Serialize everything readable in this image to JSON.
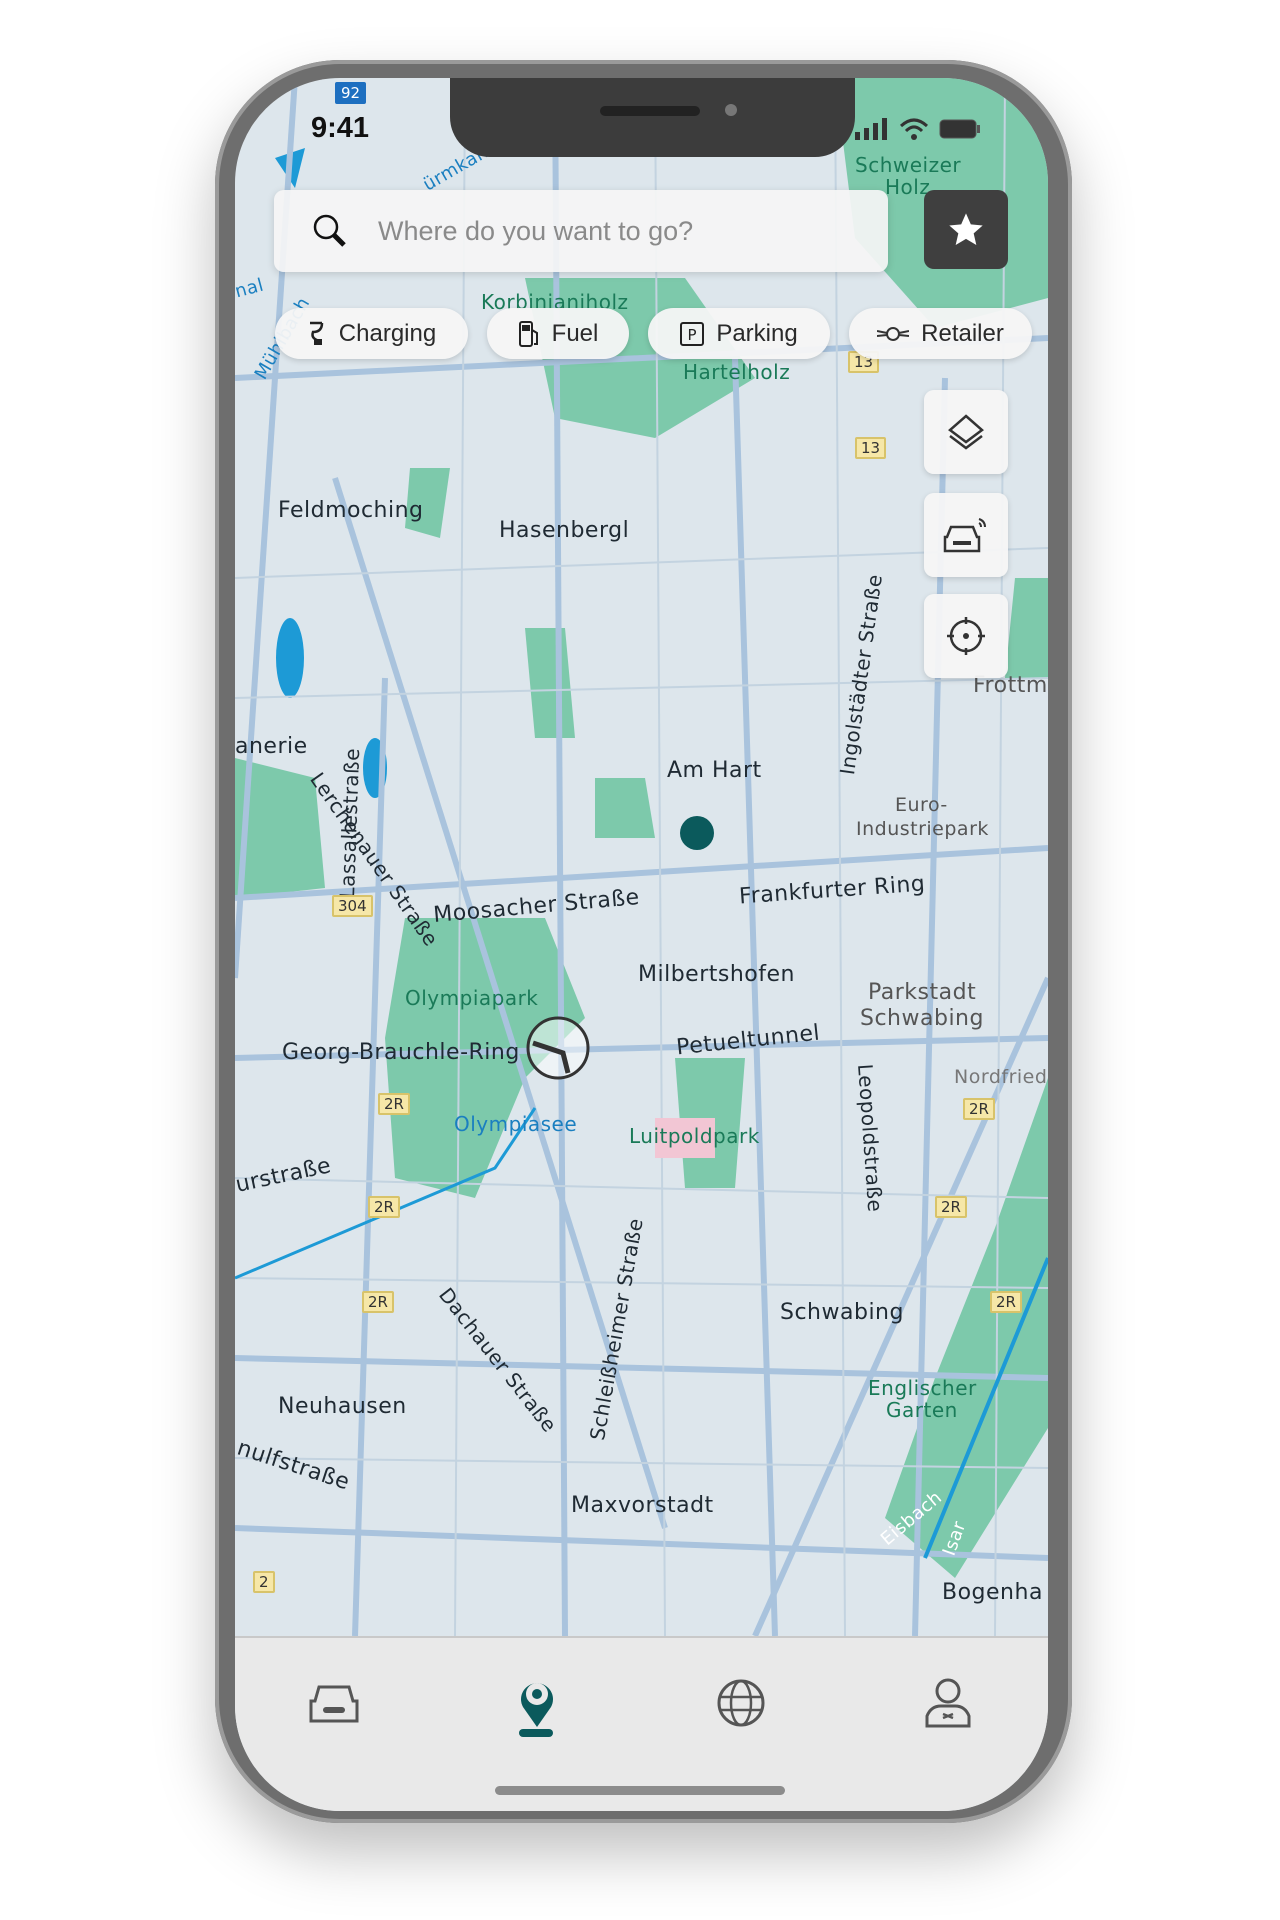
{
  "status_bar": {
    "time": "9:41"
  },
  "search": {
    "placeholder": "Where do you want to go?",
    "icon": "search-icon"
  },
  "favorites_button": {
    "icon": "star-icon"
  },
  "filter_chips": [
    {
      "label": "Charging",
      "icon": "charging-plug-icon"
    },
    {
      "label": "Fuel",
      "icon": "fuel-pump-icon"
    },
    {
      "label": "Parking",
      "icon": "parking-icon"
    },
    {
      "label": "Retailer",
      "icon": "mini-logo-icon"
    }
  ],
  "map_controls": [
    {
      "icon": "layers-icon"
    },
    {
      "icon": "car-connected-icon"
    },
    {
      "icon": "locate-crosshair-icon"
    }
  ],
  "map": {
    "labels": {
      "feldmoching": "Feldmoching",
      "hasenbergl": "Hasenbergl",
      "anerie": "anerie",
      "am_hart": "Am Hart",
      "euro1": "Euro-",
      "euro2": "Industriepark",
      "moosacher": "Moosacher Straße",
      "frankfurter": "Frankfurter Ring",
      "milbertshofen": "Milbertshofen",
      "parkstadt1": "Parkstadt",
      "parkstadt2": "Schwabing",
      "olympiapark": "Olympiapark",
      "georg": "Georg-Brauchle-Ring",
      "petuel": "Petueltunnel",
      "olympiasee": "Olympiasee",
      "luitpold": "Luitpoldpark",
      "nordfried": "Nordfried",
      "schwabing": "Schwabing",
      "englischer1": "Englischer",
      "englischer2": "Garten",
      "neuhausen": "Neuhausen",
      "maxvorstadt": "Maxvorstadt",
      "bogenha": "Bogenha",
      "lerchenauer": "Lerchenauer Straße",
      "lassalle": "Lassallestraße",
      "ingolstaedter": "Ingolstädter Straße",
      "leopold": "Leopoldstraße",
      "dachauer": "Dachauer Straße",
      "schleissheimer": "Schleißheimer Straße",
      "schweizer1": "Schweizer",
      "schweizer2": "Holz",
      "korbinian": "Korbinianiholz",
      "hartelholz": "Hartelholz",
      "frottm": "Frottm",
      "urstrasse": "urstraße",
      "nulfstrasse": "nulfstraße",
      "isar": "Isar",
      "eisbach": "Eisbach",
      "muehlbach": "Mühlbach",
      "wuermkanal": "ürmkan",
      "nal": "nal"
    },
    "road_badges": {
      "b92": "92",
      "b304": "304",
      "b2r": "2R",
      "b13": "13",
      "b2": "2"
    },
    "colors": {
      "land": "#dde6ec",
      "road": "#a9c3dd",
      "park": "#6cc3a0",
      "water": "#1d9ad6",
      "accent": "#0b5a5c"
    }
  },
  "tab_bar": {
    "items": [
      {
        "icon": "car-icon"
      },
      {
        "icon": "map-pin-icon",
        "active": true
      },
      {
        "icon": "globe-icon"
      },
      {
        "icon": "user-icon"
      }
    ]
  }
}
